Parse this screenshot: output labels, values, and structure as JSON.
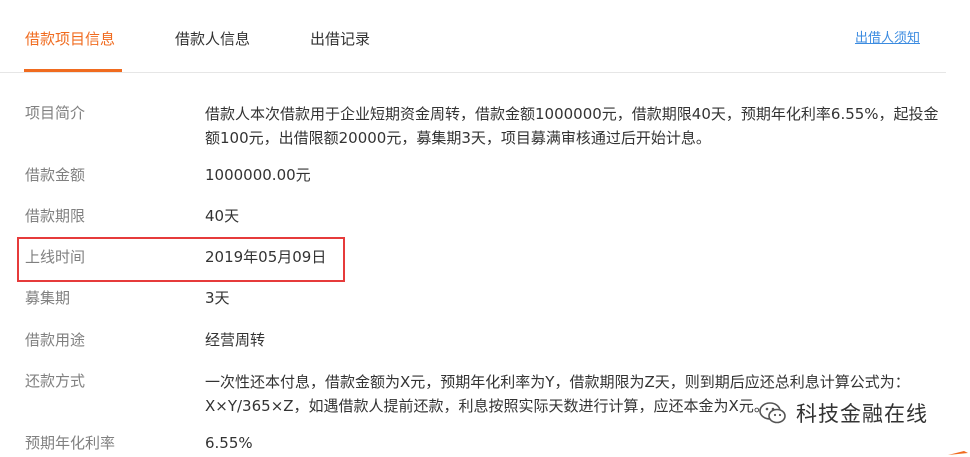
{
  "tabs": [
    {
      "label": "借款项目信息",
      "active": true
    },
    {
      "label": "借款人信息",
      "active": false
    },
    {
      "label": "出借记录",
      "active": false
    }
  ],
  "notice_link": "出借人须知",
  "details": {
    "intro": {
      "label": "项目简介",
      "text": "借款人本次借款用于企业短期资金周转，借款金额1000000元，借款期限40天，预期年化利率6.55%，起投金额100元，出借限额20000元，募集期3天，项目募满审核通过后开始计息。"
    },
    "amount": {
      "label": "借款金额",
      "value": "1000000.00元"
    },
    "term": {
      "label": "借款期限",
      "value": "40天"
    },
    "online_time": {
      "label": "上线时间",
      "value": "2019年05月09日"
    },
    "raise_period": {
      "label": "募集期",
      "value": "3天"
    },
    "purpose": {
      "label": "借款用途",
      "value": "经营周转"
    },
    "repayment": {
      "label": "还款方式",
      "text": "一次性还本付息，借款金额为X元，预期年化利率为Y，借款期限为Z天，则到期后应还总利息计算公式为：X×Y/365×Z，如遇借款人提前还款，利息按照实际天数进行计算，应还本金为X元。"
    },
    "rate": {
      "label": "预期年化利率",
      "value": "6.55%"
    }
  },
  "watermark": {
    "text": "科技金融在线"
  },
  "colors": {
    "accent": "#f06b1f",
    "link": "#3b8be0",
    "highlight_border": "#e63b3b",
    "label": "#808080"
  }
}
